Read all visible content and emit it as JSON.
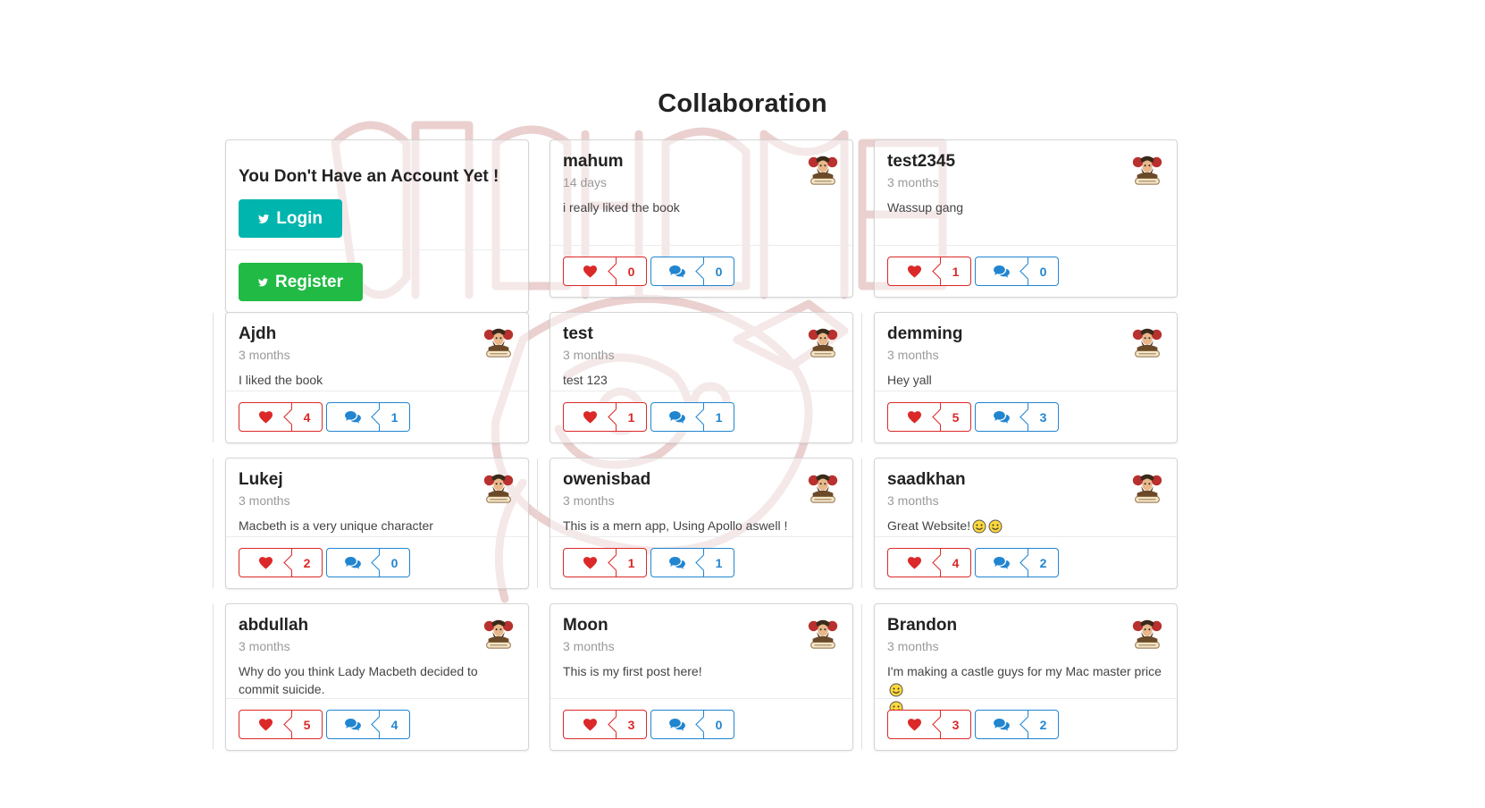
{
  "page": {
    "title": "Collaboration"
  },
  "auth": {
    "heading": "You Don't Have an Account Yet !",
    "login_label": "Login",
    "register_label": "Register"
  },
  "posts": [
    {
      "username": "mahum",
      "time": "14 days",
      "body": "i really liked the book",
      "likes": "0",
      "comments": "0"
    },
    {
      "username": "test2345",
      "time": "3 months",
      "body": "Wassup gang",
      "likes": "1",
      "comments": "0"
    },
    {
      "username": "Ajdh",
      "time": "3 months",
      "body": "I liked the book",
      "likes": "4",
      "comments": "1"
    },
    {
      "username": "test",
      "time": "3 months",
      "body": "test 123",
      "likes": "1",
      "comments": "1"
    },
    {
      "username": "demming",
      "time": "3 months",
      "body": "Hey yall",
      "likes": "5",
      "comments": "3"
    },
    {
      "username": "Lukej",
      "time": "3 months",
      "body": "Macbeth is a very unique character",
      "likes": "2",
      "comments": "0"
    },
    {
      "username": "owenisbad",
      "time": "3 months",
      "body": "This is a mern app, Using Apollo aswell !",
      "likes": "1",
      "comments": "1"
    },
    {
      "username": "saadkhan",
      "time": "3 months",
      "body": "Great Website!",
      "likes": "4",
      "comments": "2"
    },
    {
      "username": "abdullah",
      "time": "3 months",
      "body": "Why do you think Lady Macbeth decided to commit suicide.",
      "likes": "5",
      "comments": "4"
    },
    {
      "username": "Moon",
      "time": "3 months",
      "body": "This is my first post here!",
      "likes": "3",
      "comments": "0"
    },
    {
      "username": "Brandon",
      "time": "3 months",
      "body": "I'm making a castle guys for my Mac master price",
      "likes": "3",
      "comments": "2"
    }
  ],
  "icons": {
    "like": "heart-icon",
    "comment": "comments-icon",
    "brand": "twitter-icon",
    "avatar": "macbeth-avatar"
  },
  "colors": {
    "like": "#db2828",
    "comment": "#2185d0",
    "login": "#00b5ad",
    "register": "#21ba45",
    "watermark": "#e8c8c8"
  }
}
